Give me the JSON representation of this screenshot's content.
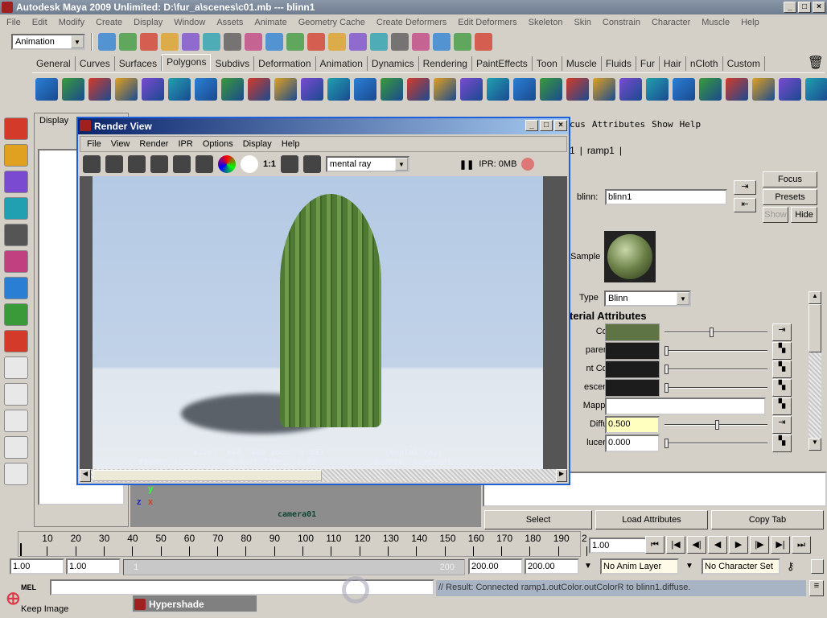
{
  "window": {
    "title": "Autodesk Maya 2009 Unlimited: D:\\fur_a\\scenes\\c01.mb   ---   blinn1",
    "controls": [
      "_",
      "□",
      "×"
    ]
  },
  "menubar": [
    "File",
    "Edit",
    "Modify",
    "Create",
    "Display",
    "Window",
    "Assets",
    "Animate",
    "Geometry Cache",
    "Create Deformers",
    "Edit Deformers",
    "Skeleton",
    "Skin",
    "Constrain",
    "Character",
    "Muscle",
    "Help"
  ],
  "statusline": {
    "mode": "Animation",
    "icons": [
      "new-scene",
      "open-scene",
      "save-scene",
      "select-hierarchy",
      "select-object",
      "select-component",
      "snap-grid",
      "snap-curve",
      "snap-point",
      "snap-plane",
      "snap-view",
      "make-live",
      "render-current",
      "render-sequence",
      "ipr-render",
      "render-settings",
      "hypershade",
      "show-render-view",
      "render-globals"
    ]
  },
  "shelf": {
    "tabs": [
      "General",
      "Curves",
      "Surfaces",
      "Polygons",
      "Subdivs",
      "Deformation",
      "Animation",
      "Dynamics",
      "Rendering",
      "PaintEffects",
      "Toon",
      "Muscle",
      "Fluids",
      "Fur",
      "Hair",
      "nCloth",
      "Custom"
    ],
    "active": "Polygons",
    "icons": [
      "poly-sphere",
      "poly-cube",
      "poly-cylinder",
      "poly-cone",
      "poly-plane",
      "poly-torus",
      "poly-pyramid",
      "poly-pipe",
      "combine",
      "separate",
      "extract",
      "smooth",
      "boolean-union",
      "boolean-difference",
      "boolean-intersection",
      "mirror",
      "extrude",
      "bridge",
      "append",
      "split",
      "insert-edge-loop",
      "offset-edge-loop",
      "wedge",
      "poke",
      "bevel",
      "planar-map",
      "cylindrical-map",
      "spherical-map",
      "automatic-map",
      "uv-editor",
      "create-uvs"
    ]
  },
  "toolbox": [
    "select-tool",
    "lasso-tool",
    "paint-select-tool",
    "move-tool",
    "rotate-tool",
    "scale-tool",
    "universal-manipulator",
    "soft-mod-tool",
    "show-manipulator",
    "single-pane-layout",
    "four-pane-layout",
    "outliner-layout",
    "persp-outliner-layout",
    "hypershade-layout"
  ],
  "outliner": {
    "menu": "Display"
  },
  "viewport": {
    "camera": "camera01",
    "axis": {
      "y": "y",
      "z": "z",
      "x": "x"
    }
  },
  "render_view": {
    "title": "Render View",
    "menu": [
      "File",
      "View",
      "Render",
      "IPR",
      "Options",
      "Display",
      "Help"
    ],
    "tools": [
      "redo-render",
      "render-region",
      "snapshot",
      "ipr-render",
      "refresh-ipr",
      "render-sequence",
      "rgb-channels",
      "alpha-channel",
      "keep-image",
      "remove-image"
    ],
    "ratio": "1:1",
    "renderer": "mental ray",
    "ipr_status": "IPR: 0MB",
    "overlay": {
      "size": "size:  640  480 zoom: 0.893",
      "renderer": "(mental ray)",
      "frame": "Frame: 1",
      "time": "Render Time:  1:05",
      "camera": "Camera: camera01"
    }
  },
  "attribute_editor": {
    "menu": [
      "cus",
      "Attributes",
      "Show",
      "Help"
    ],
    "tabs": [
      "1",
      "ramp1"
    ],
    "node_label": "blinn:",
    "node_name": "blinn1",
    "buttons": {
      "focus": "Focus",
      "presets": "Presets",
      "show": "Show",
      "hide": "Hide"
    },
    "sample_label": "Sample",
    "type_label": "Type",
    "type_value": "Blinn",
    "section": "terial Attributes",
    "attributes": [
      {
        "label": "Color",
        "swatch": "#5e7444",
        "slider": 0.45,
        "map": "connected"
      },
      {
        "label": "parency",
        "swatch": "#1c1c1c",
        "slider": 0,
        "map": "checker"
      },
      {
        "label": "nt Color",
        "swatch": "#1c1c1c",
        "slider": 0,
        "map": "checker"
      },
      {
        "label": "escence",
        "swatch": "#1c1c1c",
        "slider": 0,
        "map": "checker"
      },
      {
        "label": "Mapping",
        "field": "",
        "map": "checker"
      },
      {
        "label": "Diffuse",
        "value": "0.500",
        "slider": 0.5,
        "map": "connected",
        "highlight": "#ffffc0"
      },
      {
        "label": "lucence",
        "value": "0.000",
        "slider": 0,
        "map": "checker"
      }
    ],
    "footer": {
      "select": "Select",
      "load": "Load Attributes",
      "copy": "Copy Tab"
    }
  },
  "timeline": {
    "ticks": [
      "10",
      "20",
      "30",
      "40",
      "50",
      "60",
      "70",
      "80",
      "90",
      "100",
      "110",
      "120",
      "130",
      "140",
      "150",
      "160",
      "170",
      "180",
      "190",
      "2"
    ],
    "current": "1.00",
    "playback": [
      "go-to-start",
      "step-back-frame",
      "step-back-key",
      "play-backwards",
      "play-forwards",
      "step-forward-key",
      "step-forward-frame",
      "go-to-end"
    ]
  },
  "range": {
    "start": "1.00",
    "inner_start": "1.00",
    "slider_start": "1",
    "slider_end": "200",
    "inner_end": "200.00",
    "end": "200.00",
    "anim_layer": "No Anim Layer",
    "character_set": "No Character Set"
  },
  "command": {
    "label": "MEL",
    "result": "// Result: Connected ramp1.outColor.outColorR to blinn1.diffuse."
  },
  "help_line": "Keep Image",
  "minimized": {
    "title": "Hypershade"
  },
  "watermarks": [
    "火星时代 www.hxsd.com",
    "人人素材"
  ]
}
